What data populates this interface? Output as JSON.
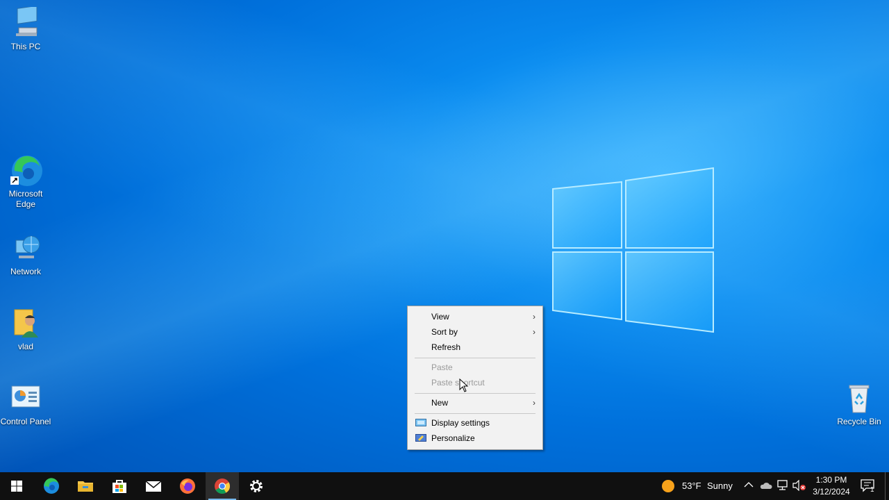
{
  "desktop": {
    "icons": [
      {
        "label": "This PC",
        "icon": "this-pc-icon"
      },
      {
        "label": "Microsoft Edge",
        "icon": "edge-icon"
      },
      {
        "label": "Network",
        "icon": "network-icon"
      },
      {
        "label": "vlad",
        "icon": "user-folder-icon"
      },
      {
        "label": "Control Panel",
        "icon": "control-panel-icon"
      },
      {
        "label": "Recycle Bin",
        "icon": "recycle-bin-icon"
      }
    ]
  },
  "context_menu": {
    "items": [
      {
        "label": "View",
        "submenu": true,
        "enabled": true
      },
      {
        "label": "Sort by",
        "submenu": true,
        "enabled": true
      },
      {
        "label": "Refresh",
        "submenu": false,
        "enabled": true
      },
      {
        "label": "Paste",
        "submenu": false,
        "enabled": false
      },
      {
        "label": "Paste shortcut",
        "submenu": false,
        "enabled": false
      },
      {
        "label": "New",
        "submenu": true,
        "enabled": true
      },
      {
        "label": "Display settings",
        "submenu": false,
        "enabled": true,
        "icon": "display-icon"
      },
      {
        "label": "Personalize",
        "submenu": false,
        "enabled": true,
        "icon": "personalize-icon"
      }
    ]
  },
  "taskbar": {
    "pinned": [
      "start-icon",
      "edge-icon",
      "file-explorer-icon",
      "store-icon",
      "mail-icon",
      "firefox-icon",
      "chrome-icon",
      "settings-icon"
    ],
    "active": "chrome-icon",
    "weather": {
      "temp": "53°F",
      "condition": "Sunny"
    },
    "clock": {
      "time": "1:30 PM",
      "date": "3/12/2024"
    },
    "notifications_count": "1"
  },
  "colors": {
    "taskbar": "#101010",
    "accent": "#76b9ed",
    "menu_bg": "#f2f2f2"
  }
}
